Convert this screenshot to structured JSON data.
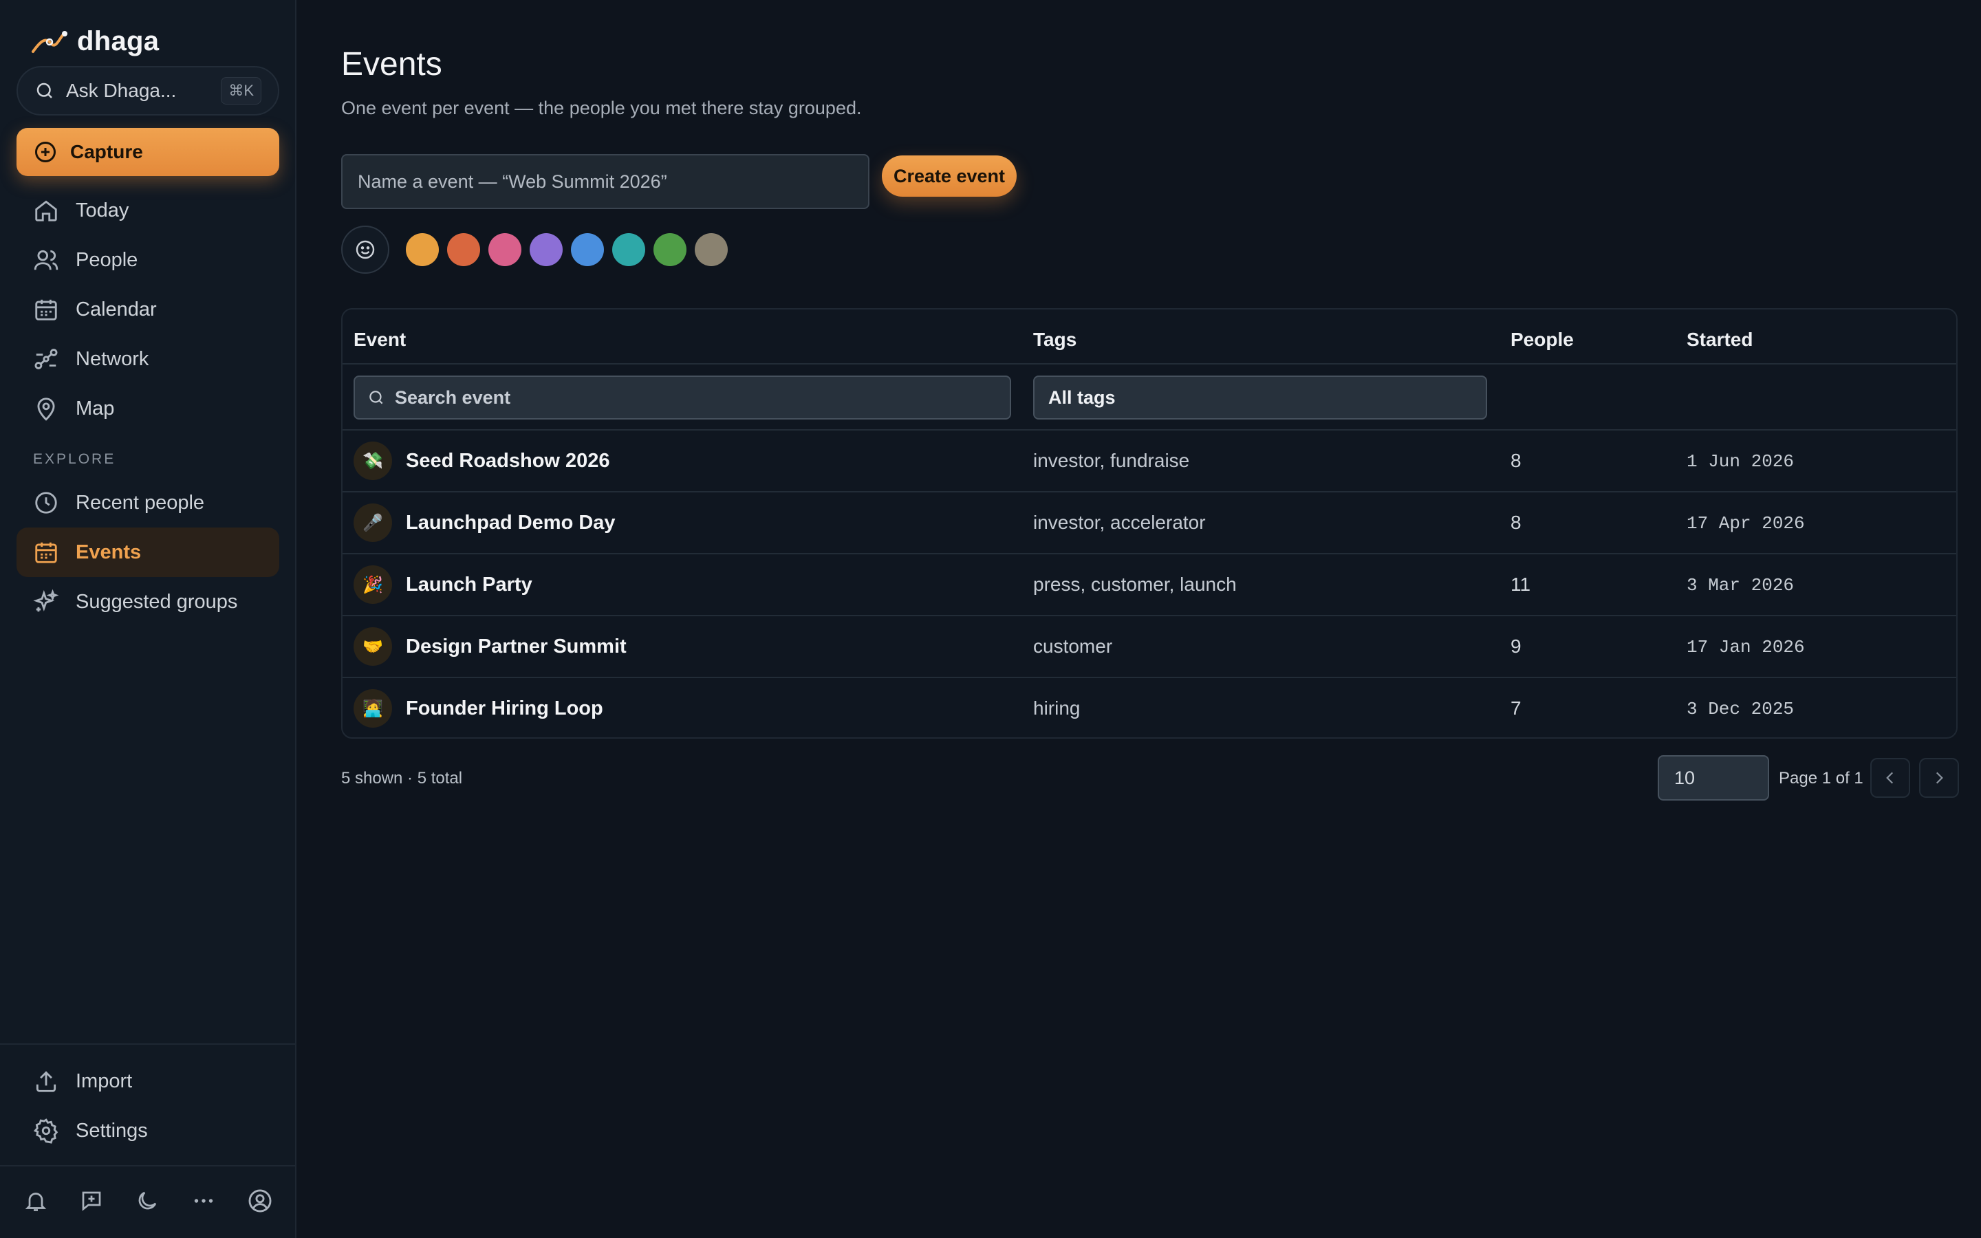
{
  "brand": {
    "name": "dhaga"
  },
  "sidebar": {
    "ask": {
      "label": "Ask Dhaga...",
      "shortcut": "⌘K"
    },
    "capture_label": "Capture",
    "items": [
      {
        "label": "Today",
        "icon": "home-icon"
      },
      {
        "label": "People",
        "icon": "users-icon"
      },
      {
        "label": "Calendar",
        "icon": "calendar-icon"
      },
      {
        "label": "Network",
        "icon": "network-icon"
      },
      {
        "label": "Map",
        "icon": "map-pin-icon"
      }
    ],
    "explore_label": "EXPLORE",
    "explore_items": [
      {
        "label": "Recent people",
        "icon": "clock-icon"
      },
      {
        "label": "Events",
        "icon": "calendar-icon",
        "active": true
      },
      {
        "label": "Suggested groups",
        "icon": "sparkles-icon"
      }
    ],
    "bottom_items": [
      {
        "label": "Import",
        "icon": "upload-icon"
      },
      {
        "label": "Settings",
        "icon": "gear-icon"
      }
    ],
    "footer_icons": [
      "bell-icon",
      "message-plus-icon",
      "moon-icon",
      "more-icon",
      "account-icon"
    ]
  },
  "main": {
    "title": "Events",
    "subtitle": "One event per event — the people you met there stay grouped.",
    "name_placeholder": "Name a event — “Web Summit 2026”",
    "create_label": "Create event",
    "color_options": [
      "#e8a040",
      "#d9673f",
      "#d9608b",
      "#8c6fd6",
      "#4a8fde",
      "#2ea8a8",
      "#4f9e47",
      "#8a8270"
    ],
    "table": {
      "columns": [
        "Event",
        "Tags",
        "People",
        "Started"
      ],
      "search_placeholder": "Search event",
      "tags_filter": "All tags",
      "rows": [
        {
          "emoji": "💸",
          "name": "Seed Roadshow 2026",
          "tags": "investor, fundraise",
          "people": "8",
          "started": "1 Jun 2026"
        },
        {
          "emoji": "🎤",
          "name": "Launchpad Demo Day",
          "tags": "investor, accelerator",
          "people": "8",
          "started": "17 Apr 2026"
        },
        {
          "emoji": "🎉",
          "name": "Launch Party",
          "tags": "press, customer, launch",
          "people": "11",
          "started": "3 Mar 2026"
        },
        {
          "emoji": "🤝",
          "name": "Design Partner Summit",
          "tags": "customer",
          "people": "9",
          "started": "17 Jan 2026"
        },
        {
          "emoji": "🧑‍💻",
          "name": "Founder Hiring Loop",
          "tags": "hiring",
          "people": "7",
          "started": "3 Dec 2025"
        }
      ]
    },
    "footer": {
      "count": "5 shown · 5 total",
      "page_size": "10",
      "page_info": "Page 1 of 1"
    }
  },
  "colors": {
    "accent": "#f0a24f",
    "background": "#0e141d",
    "sidebar": "#111923"
  }
}
